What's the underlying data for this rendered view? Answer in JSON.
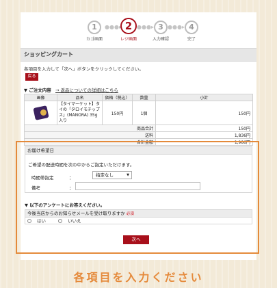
{
  "steps": [
    {
      "num": "1",
      "label": "カゴ画面"
    },
    {
      "num": "2",
      "label": "レジ画面"
    },
    {
      "num": "3",
      "label": "入力確認"
    },
    {
      "num": "4",
      "label": "完了"
    }
  ],
  "colors": {
    "accent": "#a8101b",
    "highlight": "#e48a3a"
  },
  "header": {
    "title": "ショッピングカート"
  },
  "instruction": "各項目を入力して「次へ」ボタンをクリックしてください。",
  "back_button": "戻る",
  "order": {
    "title": "▼ ご注文内容",
    "link": "→ 返品についての詳細はこちら",
    "columns": [
      "画像",
      "品名",
      "価格（税込）",
      "数量",
      "小計"
    ],
    "item": {
      "name": "【タイマーケット】タイの「タロイモチップス」(MANORA) 35g入り",
      "price": "150円",
      "qty": "1個",
      "subtotal": "150円"
    },
    "summary": [
      {
        "label": "商品合計",
        "value": "150円"
      },
      {
        "label": "送料",
        "value": "1,836円"
      },
      {
        "label": "合計金額",
        "value": "1,986円"
      }
    ]
  },
  "delivery": {
    "header": "お届け希望日",
    "desc": "ご希望の配送時間を次の中からご指定いただけます。",
    "time_label": "時間帯指定",
    "colon": "：",
    "time_value": "指定なし",
    "note_label": "備考",
    "note_value": ""
  },
  "survey": {
    "title": "▼ 以下のアンケートにお答えください。",
    "question": "今後当店からのお知らせメールを受け取りますか",
    "required": "必須",
    "options": [
      "はい",
      "いいえ"
    ]
  },
  "next_button": "次へ",
  "caption": "各項目を入力ください"
}
